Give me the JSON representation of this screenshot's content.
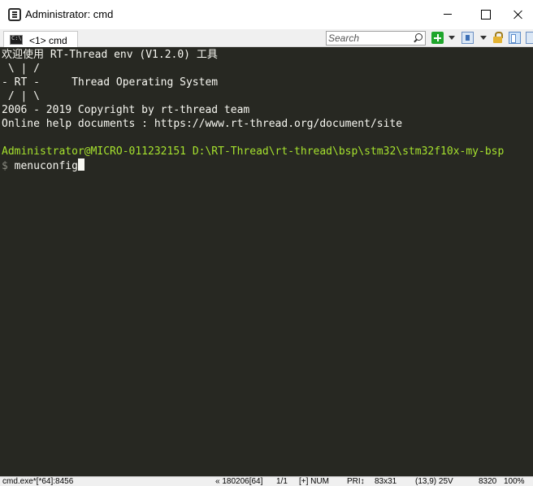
{
  "window": {
    "title": "Administrator: cmd"
  },
  "tabs": [
    {
      "label": "<1> cmd"
    }
  ],
  "search": {
    "placeholder": "Search",
    "value": ""
  },
  "console": {
    "lines": [
      "欢迎使用 RT-Thread env (V1.2.0) 工具",
      " \\ | /",
      "- RT -     Thread Operating System",
      " / | \\",
      "2006 - 2019 Copyright by rt-thread team",
      "Online help documents : https://www.rt-thread.org/document/site"
    ],
    "prompt_user": "Administrator@MICRO-011232151",
    "prompt_path": "D:\\RT-Thread\\rt-thread\\bsp\\stm32\\stm32f10x-my-bsp",
    "prompt_symbol": "$",
    "command": "menuconfig"
  },
  "statusbar": {
    "process": "cmd.exe*[*64]:8456",
    "position": "« 180206[64]",
    "page": "1/1",
    "flags": "[+] NUM",
    "priority": "PRI↕",
    "size": "83x31",
    "cursor": "(13,9) 25V",
    "pid": "8320",
    "zoom": "100%"
  },
  "colors": {
    "console_bg": "#272822",
    "console_fg": "#f8f8f2",
    "prompt_green": "#a6e22e"
  }
}
